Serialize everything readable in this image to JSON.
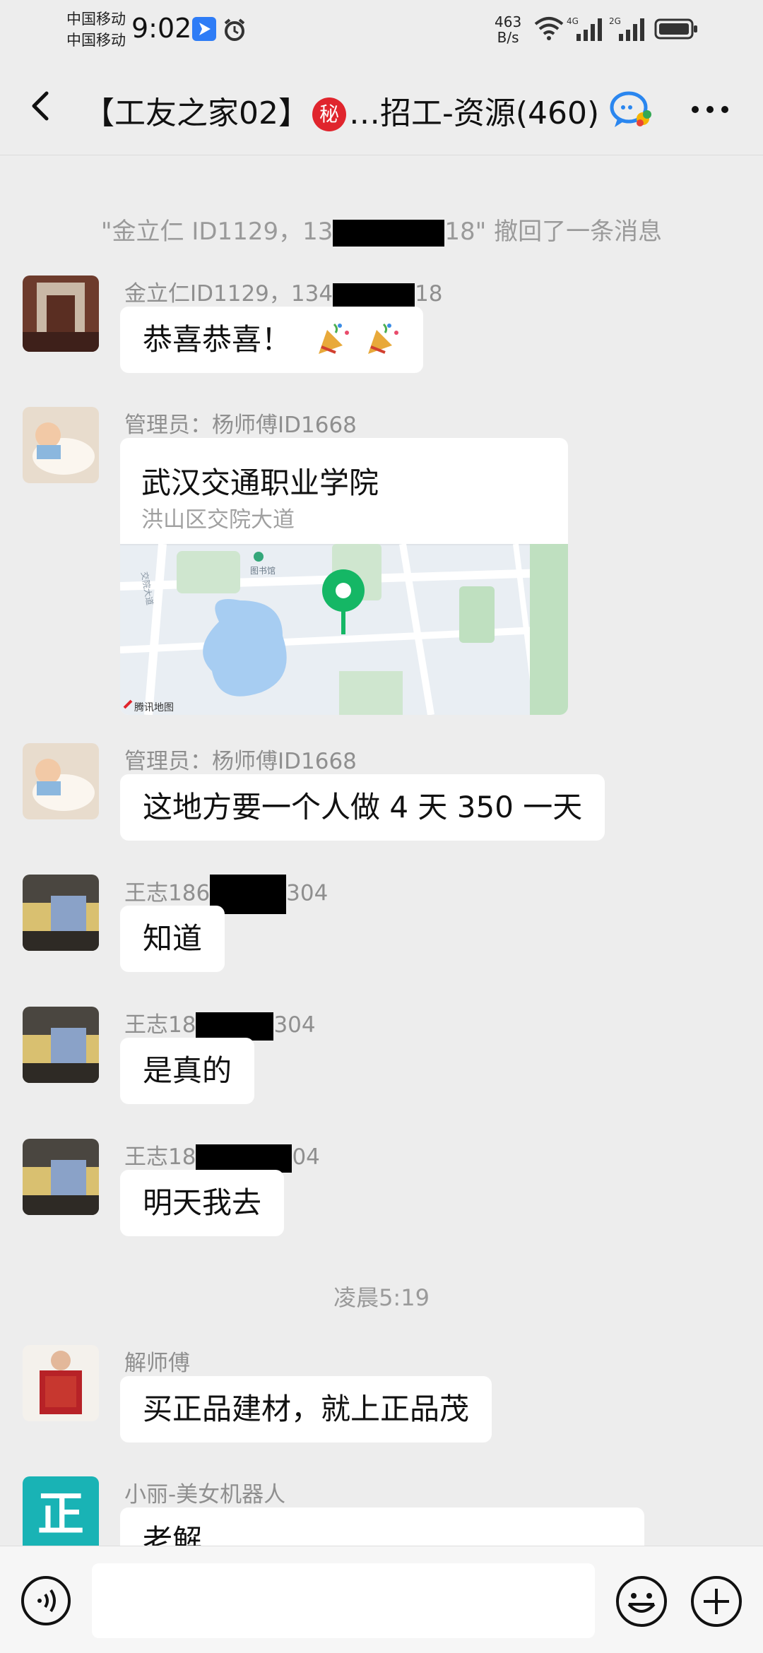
{
  "status_bar": {
    "carrier_1": "中国移动",
    "carrier_2": "中国移动",
    "time": "9:02",
    "net_speed_value": "463",
    "net_speed_unit": "B/s"
  },
  "header": {
    "title_prefix": "【工友之家02】",
    "secret_badge": "秘",
    "title_suffix": "…招工-资源(460)"
  },
  "messages": {
    "recall_notice_start": "\"金立仁 ID1129，13",
    "recall_notice_end": "18\" 撤回了一条消息",
    "m1": {
      "sender_start": "金立仁ID1129，134",
      "sender_end": "18",
      "text": "恭喜恭喜！"
    },
    "m2": {
      "sender": "管理员：杨师傅ID1668",
      "location_name": "武汉交通职业学院",
      "location_address": "洪山区交院大道",
      "map_label_library": "图书馆",
      "map_label_road": "交院大道",
      "map_brand": "腾讯地图"
    },
    "m3": {
      "sender": "管理员：杨师傅ID1668",
      "text": "这地方要一个人做 4 天 350 一天"
    },
    "m4": {
      "sender_start": "王志186",
      "sender_end": "304",
      "text": "知道"
    },
    "m5": {
      "sender_start": "王志18",
      "sender_end": "304",
      "text": "是真的"
    },
    "m6": {
      "sender_start": "王志18",
      "sender_end": "04",
      "text": "明天我去"
    },
    "time_divider": "凌晨5:19",
    "m7": {
      "sender": "解师傅",
      "text": "买正品建材，就上正品茂"
    },
    "m8": {
      "sender": "小丽-美女机器人",
      "avatar_char": "正",
      "text": "老解"
    }
  },
  "input_bar": {
    "placeholder": ""
  },
  "colors": {
    "background": "#ededed",
    "bubble": "#ffffff",
    "map_pin": "#15b765",
    "secret_badge": "#e0252d"
  },
  "icons": [
    "back-arrow-icon",
    "secret-badge",
    "group-chat-icon",
    "more-icon",
    "voice-icon",
    "emoji-icon",
    "plus-icon",
    "map-pin-icon",
    "party-popper-icon"
  ]
}
